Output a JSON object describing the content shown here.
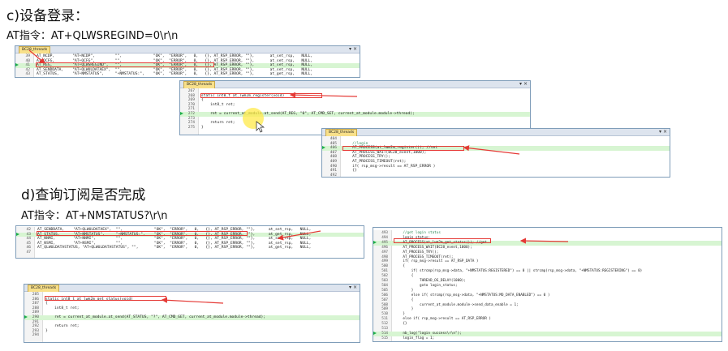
{
  "section_c": {
    "heading": "c)设备登录：",
    "at_command": "AT指令：AT+QLWSREGIND=0\\r\\n"
  },
  "section_d": {
    "heading": "d)查询订阅是否完成",
    "at_command": "AT指令：AT+NMSTATUS?\\r\\n"
  },
  "windows": {
    "w1": {
      "tab_label": "BC28_threads",
      "controls": "▾ ×",
      "lines": [
        {
          "ln": "39",
          "text": "AT_NCDP,        \"AT+NCDP\",         \"\",              \"OK\",  \"ERROR\",   0,   {}, AT_RSP_ERROR, \"\"},       at_set_rsp,   NULL,"
        },
        {
          "ln": "40",
          "text": "AT_QCFG,        \"AT+QCFG\",         \"\",              \"OK\",  \"ERROR\",   0,   {}, AT_RSP_ERROR, \"\"},       at_set_rsp,   NULL,"
        },
        {
          "ln": "41",
          "text": "AT_REG,         \"AT+QLWSREGIND\",   \"\",              \"OK\",  \"ERROR\",   0,   {}, AT_RSP_ERROR, \"\"},       at_set_rsp,   NULL,"
        },
        {
          "ln": "42",
          "text": "AT_SENDDATA,    \"AT+QLWULDATAEX\",  \"\",              \"OK\",  \"ERROR\",   0,   {}, AT_RSP_ERROR, \"\"},       at_set_rsp,   NULL,"
        },
        {
          "ln": "43",
          "text": "AT_STATUS,      \"AT+NMSTATUS\",     \"+NMSTATUS:\",    \"OK\",  \"ERROR\",   0,   {}, AT_RSP_ERROR, \"\"},       at_get_rsp,   NULL,"
        }
      ]
    },
    "w2": {
      "tab_label": "BC28_threads",
      "controls": "▾ ×",
      "lines": [
        {
          "ln": "267",
          "text": ""
        },
        {
          "ln": "268",
          "text": "static int8_t at_lwm2m_register(void)"
        },
        {
          "ln": "269",
          "text": "{"
        },
        {
          "ln": "270",
          "text": "    int8_t ret;"
        },
        {
          "ln": "271",
          "text": ""
        },
        {
          "ln": "272",
          "text": "    ret = current_at_module.at_send(AT_REG, \"0\", AT_CMD_SET, current_at_module.module->thread);"
        },
        {
          "ln": "273",
          "text": ""
        },
        {
          "ln": "274",
          "text": "    return ret;"
        },
        {
          "ln": "275",
          "text": "}"
        }
      ]
    },
    "w3": {
      "tab_label": "BC28_threads",
      "controls": "▾ ×",
      "lines": [
        {
          "ln": "404",
          "text": ""
        },
        {
          "ln": "405",
          "text": "    //login"
        },
        {
          "ln": "406",
          "text": "    AT_PROCESS(at_lwm2m_register()); //set"
        },
        {
          "ln": "407",
          "text": "    AT_PROCESS_WAIT(BC28_event,1000);"
        },
        {
          "ln": "408",
          "text": "    AT_PROCESS_TRY();"
        },
        {
          "ln": "409",
          "text": "    AT_PROCESS_TIMEOUT(ret);"
        },
        {
          "ln": "490",
          "text": "    if( rsp_msg->result == AT_RSP_ERROR )"
        },
        {
          "ln": "491",
          "text": "    {}"
        },
        {
          "ln": "492",
          "text": ""
        }
      ]
    },
    "w4": {
      "tab_label": "BC28_threads",
      "controls": "▾ ×",
      "lines": [
        {
          "ln": "42",
          "text": "AT_SENDDATA,    \"AT+QLWULDATAEX\",  \"\",              \"OK\",  \"ERROR\",   0,   {}, AT_RSP_ERROR, \"\"},      at_set_rsp,   NULL,"
        },
        {
          "ln": "43",
          "text": "AT_STATUS,      \"AT+NMSTATUS\",     \"+NMSTATUS:\",    \"OK\",  \"ERROR\",   0,   {}, AT_RSP_ERROR, \"\"},      at_get_rsp,   NULL,"
        },
        {
          "ln": "44",
          "text": "AT_NNMI,        \"AT+NNMI\",         \"\",              \"OK\",  \"ERROR\",   0,   {}, AT_RSP_ERROR, \"\"},      at_set_rsp,   NULL,"
        },
        {
          "ln": "45",
          "text": "AT_NSMI,        \"AT+NSMI\",         \"\",              \"OK\",  \"ERROR\",   0,   {}, AT_RSP_ERROR, \"\"},      at_set_rsp,   NULL,"
        },
        {
          "ln": "46",
          "text": "AT_QLWULDATASTATUS, \"AT+QLWULDATASTATUS\", \"\",       \"OK\",  \"ERROR\",   0,   {}, AT_RSP_ERROR, \"\"},      at_get_rsp,   NULL,"
        },
        {
          "ln": "47",
          "text": ""
        }
      ]
    },
    "w5": {
      "tab_label": "BC28_threads",
      "controls": "▾ ×",
      "lines": [
        {
          "ln": "285",
          "text": ""
        },
        {
          "ln": "286",
          "text": "static int8_t at_lwm2m_get_status(void)"
        },
        {
          "ln": "287",
          "text": "{"
        },
        {
          "ln": "288",
          "text": "    int8_t ret;"
        },
        {
          "ln": "289",
          "text": ""
        },
        {
          "ln": "290",
          "text": "    ret = current_at_module.at_send(AT_STATUS, \"?\", AT_CMD_GET, current_at_module.module->thread);"
        },
        {
          "ln": "291",
          "text": ""
        },
        {
          "ln": "292",
          "text": "    return ret;"
        },
        {
          "ln": "293",
          "text": "}"
        },
        {
          "ln": "294",
          "text": ""
        }
      ]
    },
    "w6": {
      "lines": [
        {
          "ln": "493",
          "text": "    //get login status"
        },
        {
          "ln": "494",
          "text": "    login_status:"
        },
        {
          "ln": "495",
          "text": "    AT_PROCESS(at_lwm2m_get_status()); //get"
        },
        {
          "ln": "496",
          "text": "    AT_PROCESS_WAIT(BC28_event,1000);"
        },
        {
          "ln": "497",
          "text": "    AT_PROCESS_TRY();"
        },
        {
          "ln": "498",
          "text": "    AT_PROCESS_TIMEOUT(ret);"
        },
        {
          "ln": "499",
          "text": "    if( rsp_msg->result == AT_RSP_DATA )"
        },
        {
          "ln": "500",
          "text": "    {"
        },
        {
          "ln": "501",
          "text": "        if( strcmp(rsp_msg->data, \"+NMSTATUS:REGISTERED\") == 0 || strcmp(rsp_msg->data, \"+NMSTATUS:REGISTERING\") == 0)"
        },
        {
          "ln": "502",
          "text": "        {"
        },
        {
          "ln": "503",
          "text": "            THREAD_OS_DELAY(1000);"
        },
        {
          "ln": "504",
          "text": "            goto login_status;"
        },
        {
          "ln": "505",
          "text": "        }"
        },
        {
          "ln": "506",
          "text": "        else if( strcmp(rsp_msg->data, \"+NMSTATUS:MO_DATA_ENABLED\") == 0 )"
        },
        {
          "ln": "507",
          "text": "        {"
        },
        {
          "ln": "508",
          "text": "            current_at_module.module->send_data_enable = 1;"
        },
        {
          "ln": "509",
          "text": "        }"
        },
        {
          "ln": "510",
          "text": "    }"
        },
        {
          "ln": "511",
          "text": "    else if( rsp_msg->result == AT_RSP_ERROR )"
        },
        {
          "ln": "512",
          "text": "    {}"
        },
        {
          "ln": "513",
          "text": ""
        },
        {
          "ln": "514",
          "text": "    nb_log(\"login success\\r\\n\");"
        },
        {
          "ln": "515",
          "text": "    login_flag = 1;"
        }
      ]
    }
  },
  "accent_colors": {
    "annotation_red": "#e53935",
    "highlight_green": "#d7f5d2",
    "marker_green": "#1fb04a",
    "cursor_yellow": "#ffe94a"
  }
}
